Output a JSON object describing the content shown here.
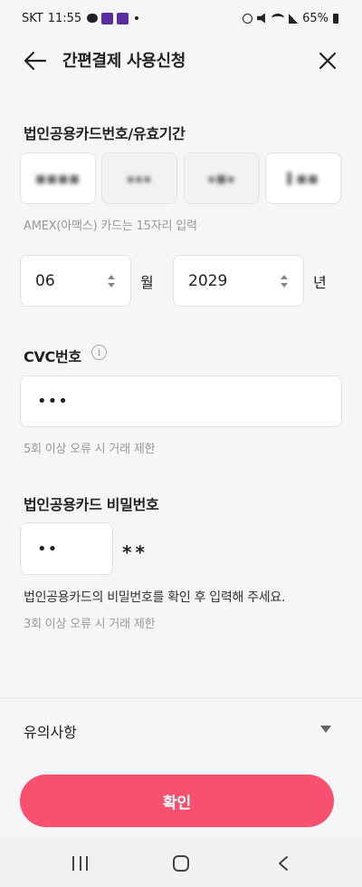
{
  "status": {
    "carrier": "SKT",
    "time": "11:55",
    "battery": "65%"
  },
  "header": {
    "title": "간편결제 사용신청"
  },
  "card": {
    "label": "법인공용카드번호/유효기간",
    "hint": "AMEX(아맥스) 카드는 15자리 입력"
  },
  "expiry": {
    "month_value": "06",
    "month_unit": "월",
    "year_value": "2029",
    "year_unit": "년"
  },
  "cvc": {
    "label": "CVC번호",
    "info_glyph": "i",
    "value": "•••",
    "hint": "5회 이상 오류 시 거래 제한"
  },
  "password": {
    "label": "법인공용카드 비밀번호",
    "value": "••",
    "masked_suffix": "**",
    "notice": "법인공용카드의 비밀번호를 확인 후 입력해 주세요.",
    "hint": "3회 이상 오류 시 거래 제한"
  },
  "caution": {
    "label": "유의사항"
  },
  "confirm": {
    "label": "확인"
  },
  "colors": {
    "accent": "#f8506f",
    "background": "#f5f6f8"
  }
}
